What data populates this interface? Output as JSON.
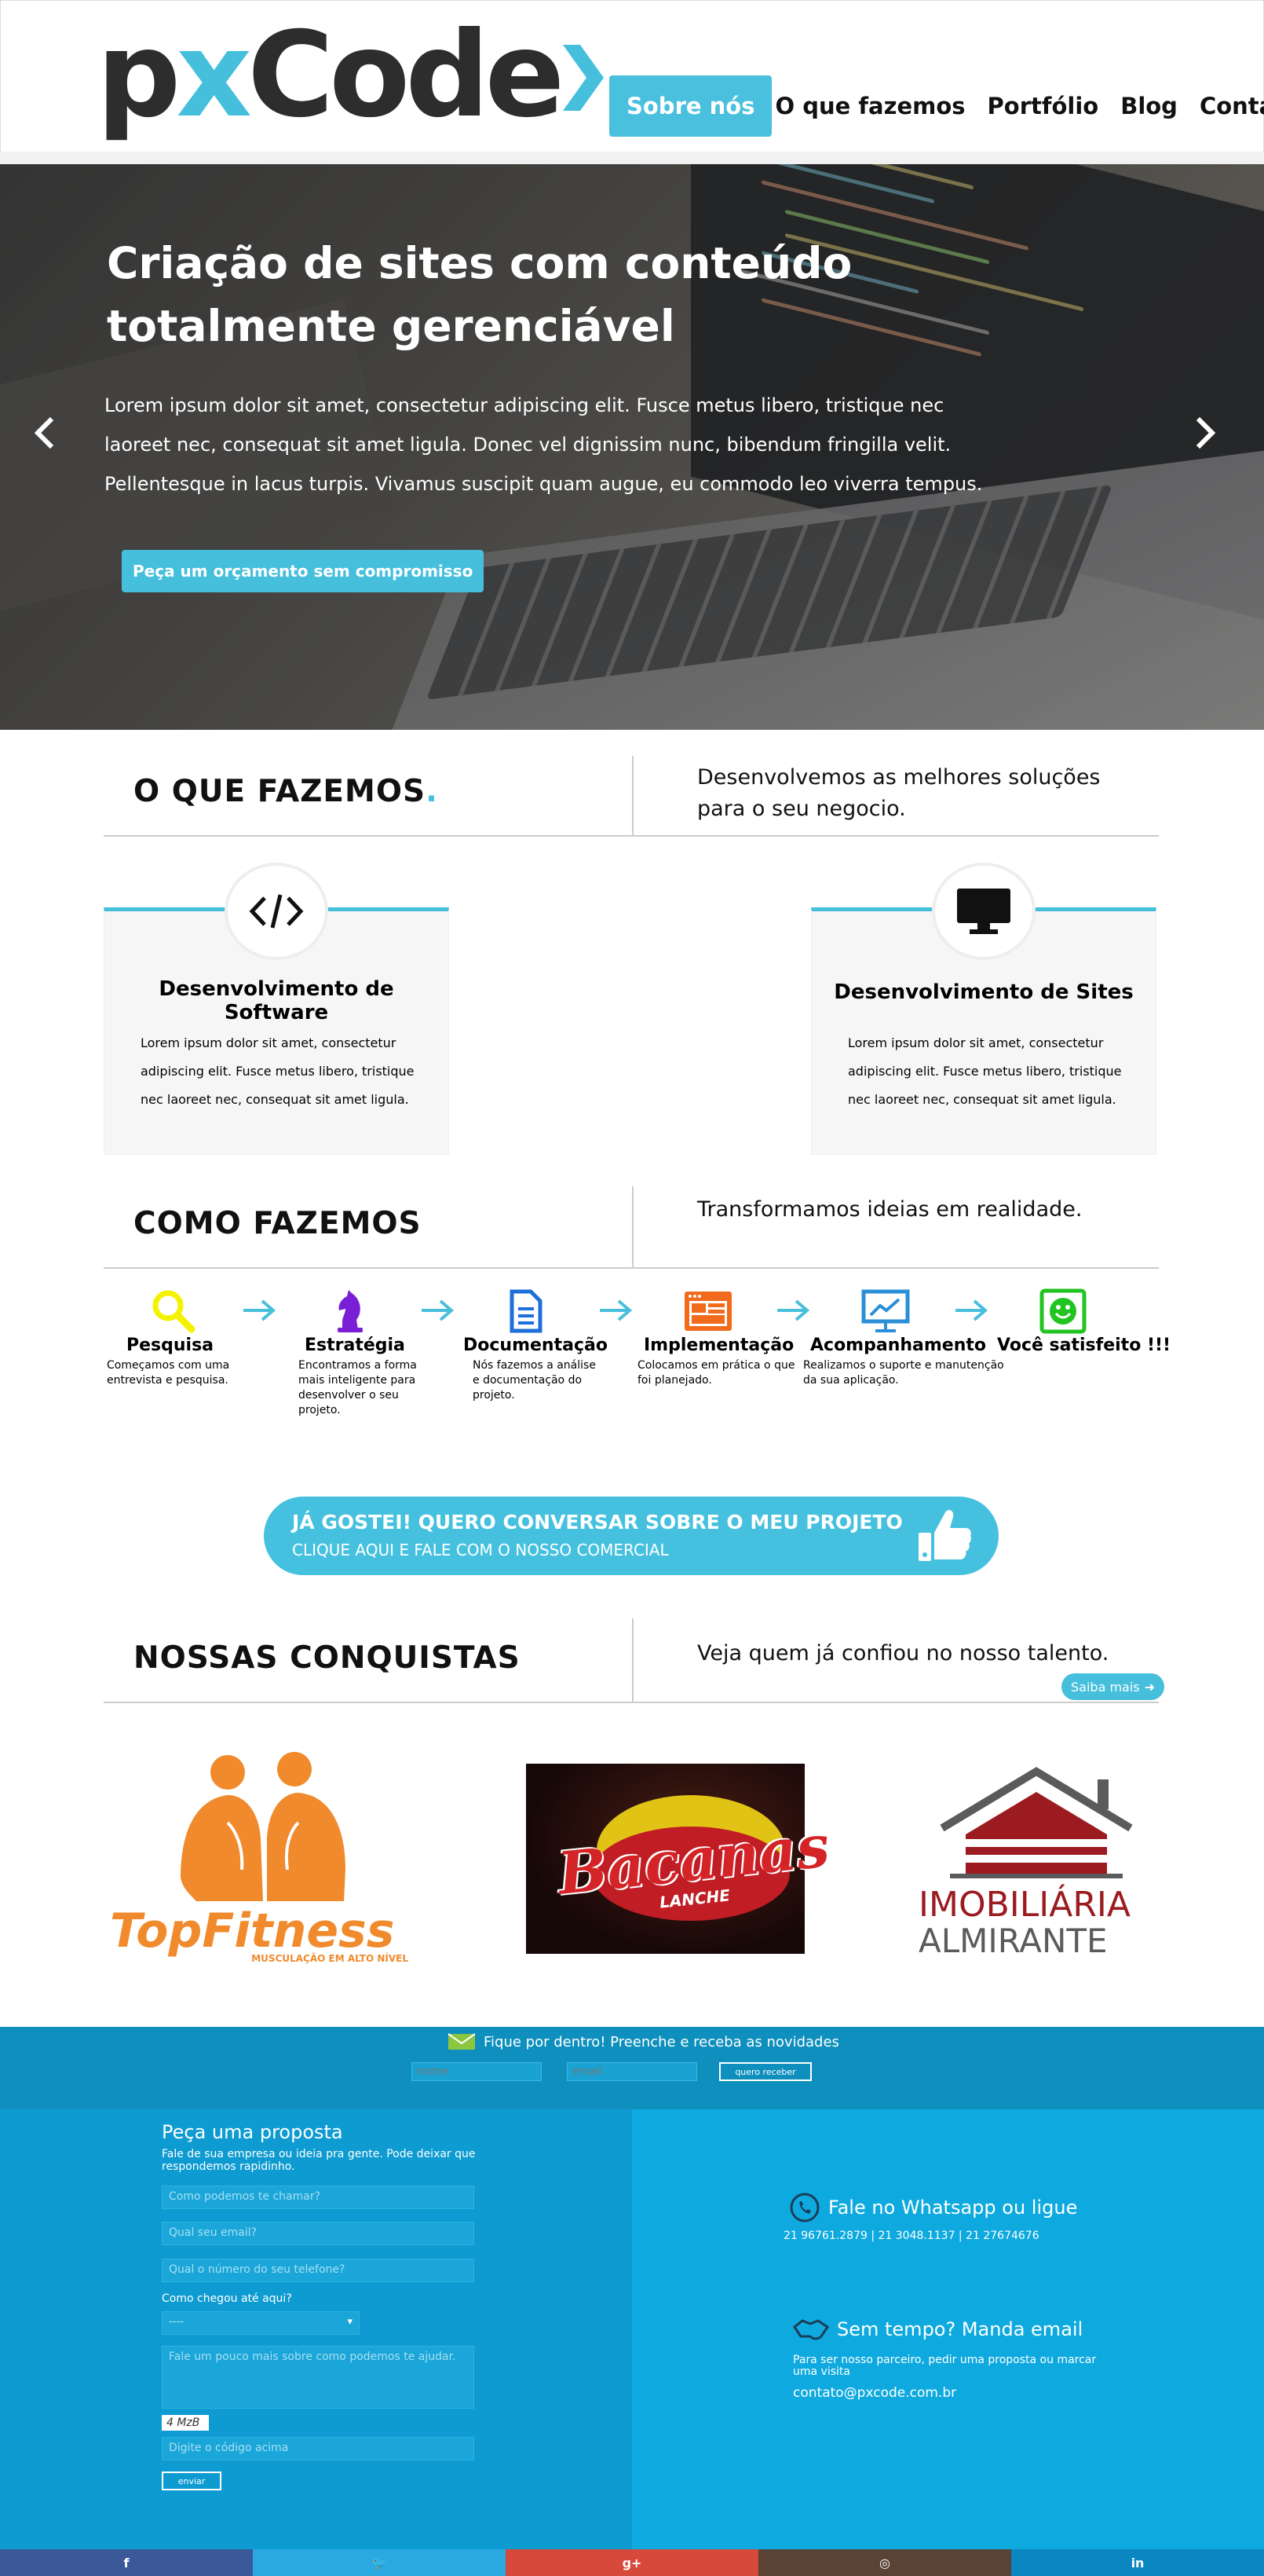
{
  "header": {
    "logo": {
      "part1": "p",
      "x": "x",
      "part2": "Code"
    },
    "nav": [
      {
        "label": "Sobre nós",
        "active": true
      },
      {
        "label": "O que fazemos"
      },
      {
        "label": "Portfólio"
      },
      {
        "label": "Blog"
      },
      {
        "label": "Contato"
      }
    ]
  },
  "hero": {
    "title": "Criação de sites com conteúdo totalmente gerenciável",
    "text": "Lorem ipsum dolor sit amet, consectetur adipiscing elit. Fusce metus libero, tristique nec laoreet nec, consequat sit amet ligula. Donec vel dignissim nunc, bibendum fringilla velit. Pellentesque in lacus turpis. Vivamus suscipit quam augue, eu commodo leo viverra tempus.",
    "cta": "Peça um orçamento sem compromisso",
    "prev_icon": "chevron-left-icon",
    "next_icon": "chevron-right-icon"
  },
  "what": {
    "title": "O QUE FAZEMOS",
    "title_dot": ".",
    "subtitle": "Desenvolvemos as melhores soluções para o seu negocio.",
    "cards": [
      {
        "icon": "code-icon",
        "title": "Desenvolvimento de Software",
        "text": "Lorem ipsum dolor sit amet, consectetur adipiscing elit. Fusce metus libero, tristique nec laoreet nec, consequat sit amet ligula."
      },
      {
        "icon": "monitor-icon",
        "title": "Desenvolvimento de Sites",
        "text": "Lorem ipsum dolor sit amet, consectetur adipiscing elit. Fusce metus libero, tristique nec laoreet nec, consequat sit amet ligula."
      }
    ]
  },
  "how": {
    "title": "COMO FAZEMOS",
    "subtitle": "Transformamos ideias em realidade.",
    "steps": [
      {
        "icon": "magnifier-icon",
        "color": "#f5f200",
        "title": "Pesquisa",
        "text": "Começamos com uma entrevista e pesquisa."
      },
      {
        "icon": "chess-knight-icon",
        "color": "#7a1fd6",
        "title": "Estratégia",
        "text": "Encontramos a forma mais inteligente para desenvolver o seu projeto."
      },
      {
        "icon": "document-icon",
        "color": "#1e6fd9",
        "title": "Documentação",
        "text": "Nós fazemos a análise e documentação do projeto."
      },
      {
        "icon": "browser-layout-icon",
        "color": "#f26b1d",
        "title": "Implementação",
        "text": "Colocamos em prática o que foi planejado."
      },
      {
        "icon": "analytics-monitor-icon",
        "color": "#2a8fd6",
        "title": "Acompanhamento",
        "text": "Realizamos o suporte e manutenção da sua aplicação."
      },
      {
        "icon": "smiley-icon",
        "color": "#22c422",
        "title": "Você satisfeito !!!",
        "text": ""
      }
    ]
  },
  "banner": {
    "line1": "JÁ GOSTEI! QUERO CONVERSAR SOBRE O MEU PROJETO",
    "line2": "CLIQUE AQUI E FALE COM O NOSSO COMERCIAL",
    "icon": "thumbs-up-icon"
  },
  "achievements": {
    "title": "NOSSAS CONQUISTAS",
    "subtitle": "Veja quem já confiou no nosso talento.",
    "more": "Saiba mais",
    "clients": [
      {
        "name": "TopFitness",
        "tagline": "MUSCULAÇÃO EM ALTO NÍVEL"
      },
      {
        "name": "Bacanas",
        "tagline": "LANCHE"
      },
      {
        "name": "IMOBILIÁRIA",
        "tagline": "ALMIRANTE"
      }
    ]
  },
  "newsletter": {
    "title": "Fique por dentro! Preenche e receba as novidades",
    "name_placeholder": "nome",
    "email_placeholder": "email",
    "button": "quero receber"
  },
  "proposal": {
    "title": "Peça uma proposta",
    "intro": "Fale de sua empresa ou ideia pra gente. Pode deixar que respondemos rapidinho.",
    "name_placeholder": "Como podemos te chamar?",
    "email_placeholder": "Qual seu email?",
    "phone_placeholder": "Qual o número do seu telefone?",
    "how_label": "Como chegou até aqui?",
    "how_value": "----",
    "message_placeholder": "Fale um pouco mais sobre como podemos te ajudar.",
    "captcha": "4 MzB",
    "captcha_placeholder": "Digite o código acima",
    "submit": "enviar"
  },
  "contact": {
    "whatsapp_title": "Fale no Whatsapp ou ligue",
    "phones": "21 96761.2879 | 21 3048.1137 | 21 27674676",
    "email_title": "Sem tempo? Manda email",
    "email_text": "Para ser nosso parceiro, pedir uma proposta ou marcar uma visita",
    "email": "contato@pxcode.com.br"
  },
  "social": [
    {
      "icon": "facebook-icon",
      "label": "f",
      "color": "#3b5998"
    },
    {
      "icon": "twitter-icon",
      "label": "🐦",
      "color": "#2aa9e0"
    },
    {
      "icon": "google-plus-icon",
      "label": "g+",
      "color": "#d6493b"
    },
    {
      "icon": "instagram-icon",
      "label": "◎",
      "color": "#5a4236"
    },
    {
      "icon": "linkedin-icon",
      "label": "in",
      "color": "#0b86c1"
    }
  ]
}
